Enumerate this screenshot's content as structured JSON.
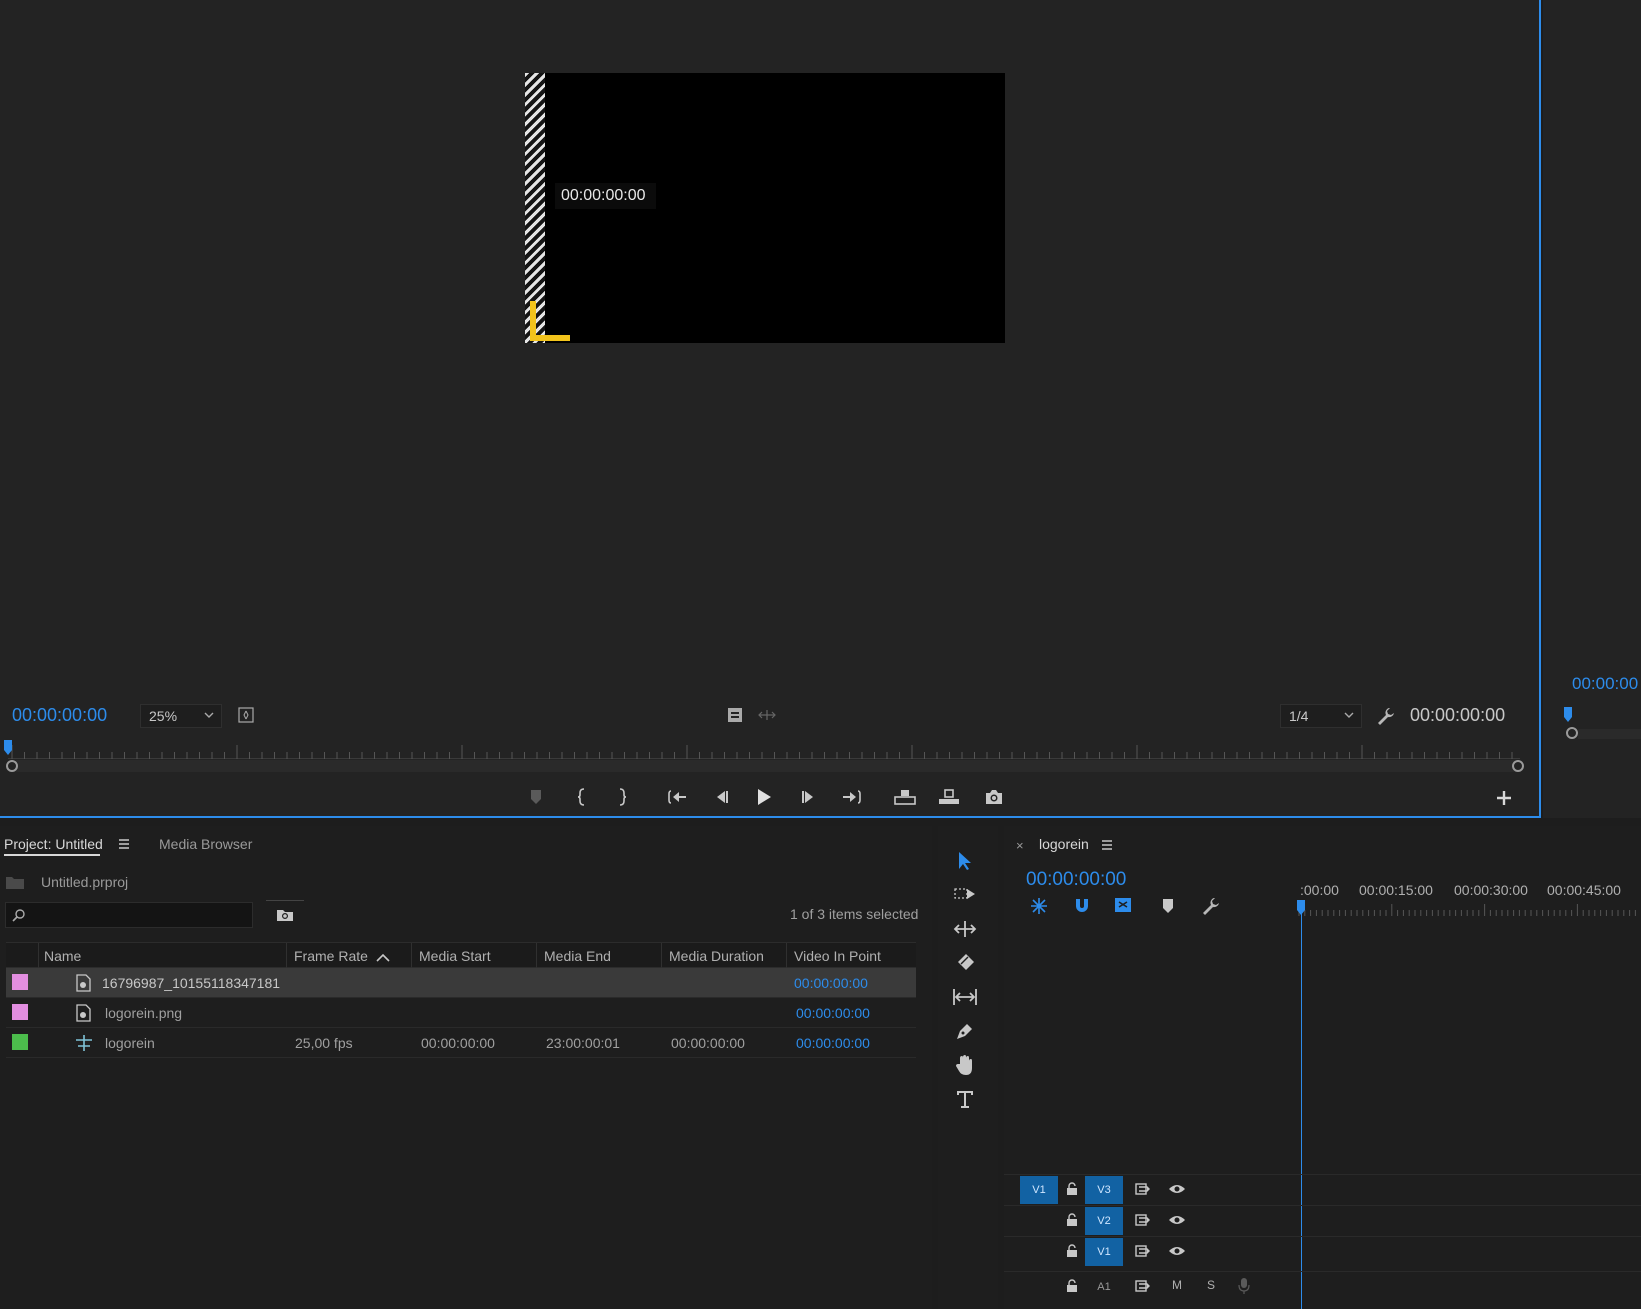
{
  "monitor": {
    "overlay_timecode": "00:00:00:00",
    "playhead_timecode": "00:00:00:00",
    "zoom": "25%",
    "resolution": "1/4",
    "duration_timecode": "00:00:00:00",
    "controls": [
      "marker",
      "mark-in",
      "mark-out",
      "go-to-in",
      "step-back",
      "play",
      "step-forward",
      "go-to-out",
      "lift",
      "extract",
      "export-frame",
      "add-button"
    ]
  },
  "right_sliver": {
    "timecode": "00:00:00"
  },
  "project": {
    "tabs": [
      {
        "label": "Project: Untitled",
        "active": true
      },
      {
        "label": "Media Browser",
        "active": false
      }
    ],
    "project_file": "Untitled.prproj",
    "search_placeholder": "",
    "selection_status": "1 of 3 items selected",
    "columns": [
      "Name",
      "Frame Rate",
      "Media Start",
      "Media End",
      "Media Duration",
      "Video In Point"
    ],
    "sort_column": "Frame Rate",
    "rows": [
      {
        "color": "#e38ee0",
        "icon": "image-sequence-icon",
        "name": "16796987_10155118347181",
        "frame_rate": "",
        "media_start": "",
        "media_end": "",
        "media_duration": "",
        "video_in_point": "00:00:00:00",
        "selected": true
      },
      {
        "color": "#e38ee0",
        "icon": "image-file-icon",
        "name": "logorein.png",
        "frame_rate": "",
        "media_start": "",
        "media_end": "",
        "media_duration": "",
        "video_in_point": "00:00:00:00",
        "selected": false
      },
      {
        "color": "#4cbd4c",
        "icon": "sequence-icon",
        "name": "logorein",
        "frame_rate": "25,00 fps",
        "media_start": "00:00:00:00",
        "media_end": "23:00:00:01",
        "media_duration": "00:00:00:00",
        "video_in_point": "00:00:00:00",
        "selected": false
      }
    ]
  },
  "tools": [
    "selection-tool",
    "track-select-tool",
    "ripple-edit-tool",
    "razor-tool",
    "slip-tool",
    "pen-tool",
    "hand-tool",
    "type-tool"
  ],
  "timeline": {
    "sequence_name": "logorein",
    "timecode": "00:00:00:00",
    "ruler_labels": [
      ":00:00",
      "00:00:15:00",
      "00:00:30:00",
      "00:00:45:00"
    ],
    "tracks": [
      {
        "source": "V1",
        "target": "V3",
        "kind": "video"
      },
      {
        "source": "",
        "target": "V2",
        "kind": "video"
      },
      {
        "source": "",
        "target": "V1",
        "kind": "video"
      },
      {
        "source": "",
        "target": "A1",
        "kind": "audio",
        "mute": "M",
        "solo": "S"
      }
    ]
  },
  "accent_color": "#2d8ceb"
}
